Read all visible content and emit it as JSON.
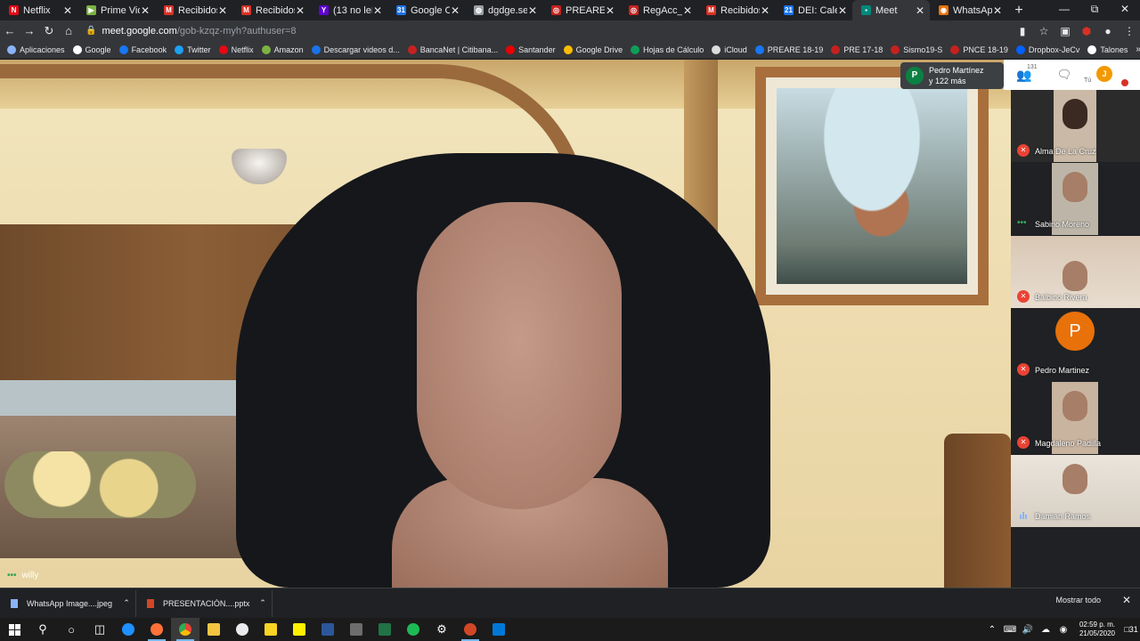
{
  "browser": {
    "tabs": [
      {
        "title": "Netflix",
        "icon": "netflix-icon",
        "color": "#e50914",
        "glyph": "N"
      },
      {
        "title": "Prime Video",
        "icon": "prime-video-icon",
        "color": "#7cb342",
        "glyph": "▶"
      },
      {
        "title": "Recibidos (1",
        "icon": "gmail-icon",
        "color": "#d93025",
        "glyph": "M"
      },
      {
        "title": "Recibidos -",
        "icon": "gmail-icon",
        "color": "#d93025",
        "glyph": "M"
      },
      {
        "title": "(13 no leído",
        "icon": "yahoo-icon",
        "color": "#6001d2",
        "glyph": "Y"
      },
      {
        "title": "Google Cale",
        "icon": "calendar-icon",
        "color": "#1a73e8",
        "glyph": "31"
      },
      {
        "title": "dgdge.sep.g",
        "icon": "globe-icon",
        "color": "#9aa0a6",
        "glyph": "◍"
      },
      {
        "title": "PREARE 201",
        "icon": "preare-icon",
        "color": "#c5221f",
        "glyph": "◎"
      },
      {
        "title": "RegAcc_Sism",
        "icon": "preare-icon",
        "color": "#c5221f",
        "glyph": "◎"
      },
      {
        "title": "Recibidos -",
        "icon": "gmail-icon",
        "color": "#d93025",
        "glyph": "M"
      },
      {
        "title": "DEI: Calend",
        "icon": "calendar-icon",
        "color": "#1a73e8",
        "glyph": "21"
      },
      {
        "title": "Meet",
        "icon": "meet-icon",
        "color": "#00897b",
        "glyph": "▪",
        "active": true
      },
      {
        "title": "WhatsApp",
        "icon": "whatsapp-icon",
        "color": "#e8710a",
        "glyph": "◉"
      }
    ],
    "url_host": "meet.google.com",
    "url_path": "/gob-kzqz-myh?authuser=8",
    "bookmarks": [
      {
        "label": "Aplicaciones",
        "icon": "apps-grid-icon",
        "color": "#8ab4f8"
      },
      {
        "label": "Google",
        "icon": "google-icon",
        "color": "#ffffff"
      },
      {
        "label": "Facebook",
        "icon": "facebook-icon",
        "color": "#1877f2"
      },
      {
        "label": "Twitter",
        "icon": "twitter-icon",
        "color": "#1da1f2"
      },
      {
        "label": "Netflix",
        "icon": "netflix-icon",
        "color": "#e50914"
      },
      {
        "label": "Amazon",
        "icon": "amazon-icon",
        "color": "#7cb342"
      },
      {
        "label": "Descargar videos d...",
        "icon": "download-icon",
        "color": "#1a73e8"
      },
      {
        "label": "BancaNet | Citibana...",
        "icon": "citibanamex-icon",
        "color": "#c5221f"
      },
      {
        "label": "Santander",
        "icon": "santander-icon",
        "color": "#ec0000"
      },
      {
        "label": "Google Drive",
        "icon": "drive-icon",
        "color": "#fbbc04"
      },
      {
        "label": "Hojas de Cálculo",
        "icon": "sheets-icon",
        "color": "#0f9d58"
      },
      {
        "label": "iCloud",
        "icon": "apple-icon",
        "color": "#dddddd"
      },
      {
        "label": "PREARE 18-19",
        "icon": "facebook-icon",
        "color": "#1877f2"
      },
      {
        "label": "PRE 17-18",
        "icon": "preare-icon",
        "color": "#c5221f"
      },
      {
        "label": "Sismo19-S",
        "icon": "preare-icon",
        "color": "#c5221f"
      },
      {
        "label": "PNCE 18-19",
        "icon": "preare-icon",
        "color": "#c5221f"
      },
      {
        "label": "Dropbox-JeCv",
        "icon": "dropbox-icon",
        "color": "#0061ff"
      },
      {
        "label": "Talones",
        "icon": "github-icon",
        "color": "#ffffff"
      }
    ]
  },
  "meet": {
    "self_name": "willy",
    "presenter_summary_line1": "Pedro Martínez",
    "presenter_summary_line2": "y 122 más",
    "presenter_initial": "P",
    "people_count": "131",
    "you_label": "Tú",
    "you_initial": "J",
    "participants": [
      {
        "name": "Alma De La Cruz",
        "status": "muted",
        "kind": "video"
      },
      {
        "name": "Sabino Moreno",
        "status": "dots",
        "kind": "video"
      },
      {
        "name": "Balbino Rivera",
        "status": "muted",
        "kind": "video"
      },
      {
        "name": "Pedro Martinez",
        "status": "muted",
        "kind": "avatar",
        "initial": "P"
      },
      {
        "name": "Magdaleno Padilla",
        "status": "muted",
        "kind": "video"
      },
      {
        "name": "Damian Ramos",
        "status": "speaking",
        "kind": "video"
      }
    ]
  },
  "downloads": {
    "items": [
      {
        "name": "WhatsApp Image....jpeg",
        "icon": "image-file-icon",
        "color": "#8ab4f8"
      },
      {
        "name": "PRESENTACIÓN....pptx",
        "icon": "powerpoint-file-icon",
        "color": "#d24726"
      }
    ],
    "show_all": "Mostrar todo"
  },
  "taskbar": {
    "time": "02:59 p. m.",
    "date": "21/05/2020",
    "notifications": "31"
  }
}
